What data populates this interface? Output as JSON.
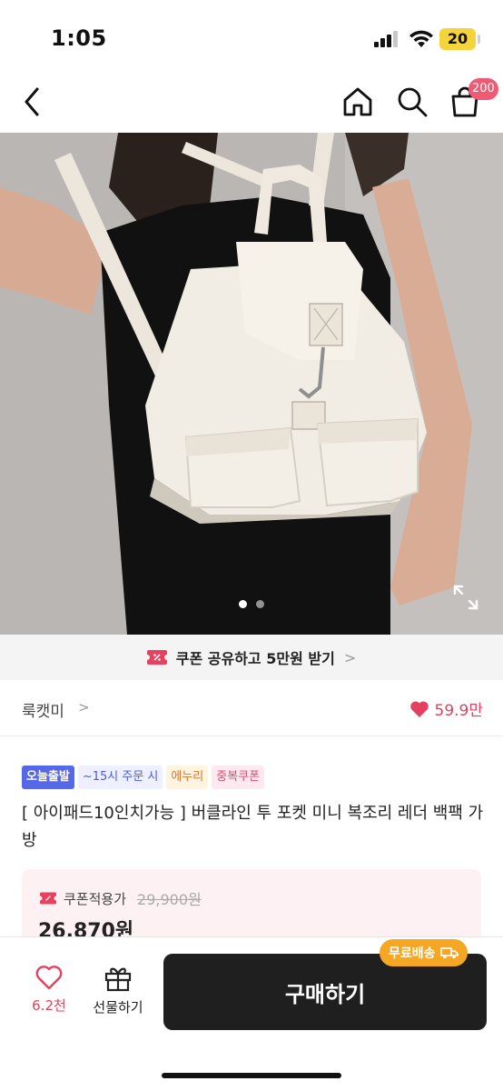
{
  "status_bar": {
    "time": "1:05",
    "battery": "20"
  },
  "nav": {
    "cart_count": "200"
  },
  "hero": {
    "image_count": 2,
    "active_index": 0
  },
  "coupon_share": {
    "label": "쿠폰 공유하고 5만원 받기",
    "arrow": ">"
  },
  "store": {
    "name": "룩캣미",
    "arrow": ">",
    "likes": "59.9만"
  },
  "badges": [
    "오늘출발",
    "~15시 주문 시",
    "에누리",
    "중복쿠폰"
  ],
  "product": {
    "title": "[ 아이패드10인치가능 ] 버클라인 투 포켓 미니 복조리 레더 백팩 가방"
  },
  "price": {
    "coupon_label": "쿠폰적용가",
    "original": "29,900원",
    "sale": "26,870원"
  },
  "bottom": {
    "wish_count": "6.2천",
    "gift_label": "선물하기",
    "buy_label": "구매하기",
    "free_shipping": "무료배송"
  },
  "colors": {
    "accent": "#e3415f",
    "badge_blue": "#5468e8",
    "free_ship": "#f5a623",
    "buy": "#1f1f1f"
  }
}
